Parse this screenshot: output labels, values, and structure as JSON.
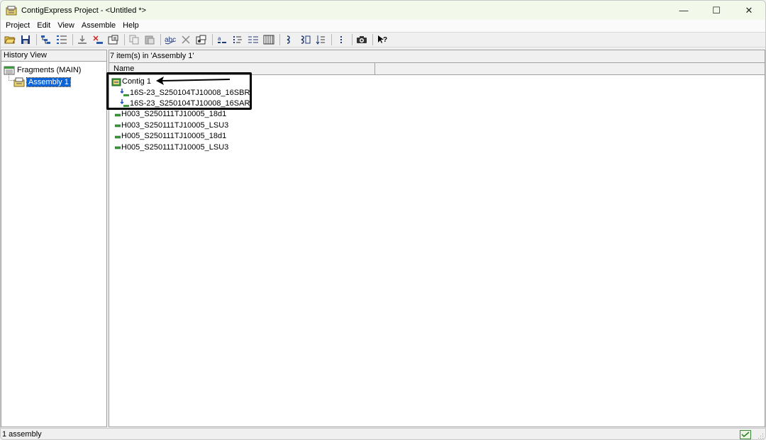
{
  "window": {
    "title": "ContigExpress Project - <Untitled *>",
    "controls": {
      "minimize": "—",
      "maximize": "☐",
      "close": "✕"
    }
  },
  "menu": [
    "Project",
    "Edit",
    "View",
    "Assemble",
    "Help"
  ],
  "toolbar": {
    "icons": [
      "open-icon",
      "save-icon",
      "sep",
      "tree-view-icon",
      "list-view-icon",
      "sep",
      "add-fragment-icon",
      "remove-fragment-icon",
      "properties-icon",
      "sep",
      "copy-icon",
      "paste-icon",
      "sep",
      "spell-icon",
      "delete-icon",
      "settings-icon",
      "sep",
      "sort-asc-icon",
      "sort-desc-icon",
      "list-detail-icon",
      "table-icon",
      "sep",
      "assemble-icon",
      "assemble-advanced-icon",
      "align-icon",
      "sep",
      "dots-icon",
      "sep",
      "camera-icon",
      "sep",
      "help-pointer-icon"
    ]
  },
  "left_pane": {
    "header": "History View",
    "tree": [
      {
        "label": "Fragments (MAIN)",
        "icon": "fragments-folder-icon",
        "level": 0
      },
      {
        "label": "Assembly 1",
        "icon": "assembly-icon",
        "level": 1,
        "selected": true
      }
    ]
  },
  "right_pane": {
    "header": "7 item(s) in 'Assembly 1'",
    "columns": [
      "Name",
      ""
    ],
    "items": [
      {
        "label": "Contig 1",
        "kind": "contig",
        "icon": "contig-icon"
      },
      {
        "label": "16S-23_S250104TJ10008_16SBR",
        "kind": "member",
        "icon": "reverse-fragment-icon"
      },
      {
        "label": "16S-23_S250104TJ10008_16SAR",
        "kind": "member",
        "icon": "reverse-fragment-icon"
      },
      {
        "label": "H003_S250111TJ10005_18d1",
        "kind": "frag",
        "icon": "fragment-icon"
      },
      {
        "label": "H003_S250111TJ10005_LSU3",
        "kind": "frag",
        "icon": "fragment-icon"
      },
      {
        "label": "H005_S250111TJ10005_18d1",
        "kind": "frag",
        "icon": "fragment-icon"
      },
      {
        "label": "H005_S250111TJ10005_LSU3",
        "kind": "frag",
        "icon": "fragment-icon"
      }
    ]
  },
  "status": {
    "text": "1 assembly"
  },
  "colors": {
    "selection": "#0a64d8",
    "titlebar": "#f3f9ea",
    "annotation": "#000000"
  }
}
